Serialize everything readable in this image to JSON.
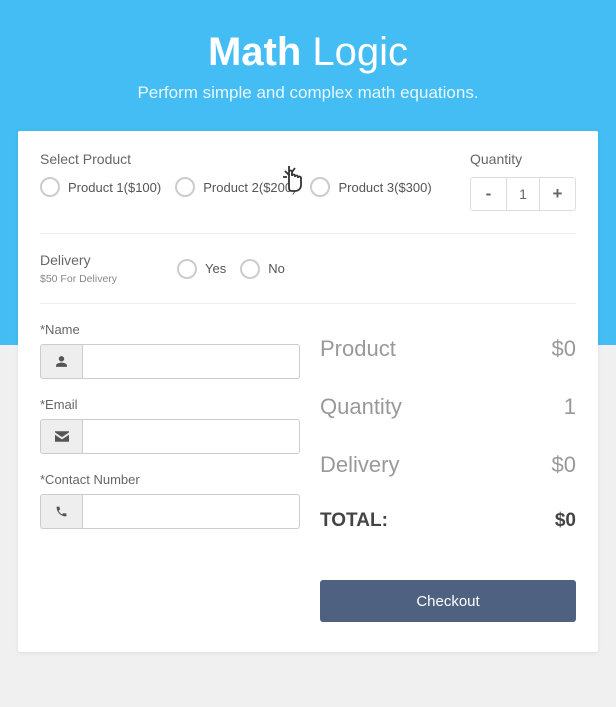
{
  "header": {
    "title_bold": "Math",
    "title_light": "Logic",
    "subtitle": "Perform simple and complex math equations."
  },
  "product": {
    "label": "Select Product",
    "options": [
      {
        "label": "Product 1($100)"
      },
      {
        "label": "Product 2($200)"
      },
      {
        "label": "Product 3($300)"
      }
    ]
  },
  "quantity": {
    "label": "Quantity",
    "minus": "-",
    "value": "1",
    "plus": "+"
  },
  "delivery": {
    "label": "Delivery",
    "note": "$50 For Delivery",
    "options": [
      {
        "label": "Yes"
      },
      {
        "label": "No"
      }
    ]
  },
  "form": {
    "name_label": "*Name",
    "email_label": "*Email",
    "contact_label": "*Contact Number"
  },
  "summary": {
    "product_label": "Product",
    "product_value": "$0",
    "quantity_label": "Quantity",
    "quantity_value": "1",
    "delivery_label": "Delivery",
    "delivery_value": "$0",
    "total_label": "TOTAL:",
    "total_value": "$0"
  },
  "checkout": "Checkout"
}
